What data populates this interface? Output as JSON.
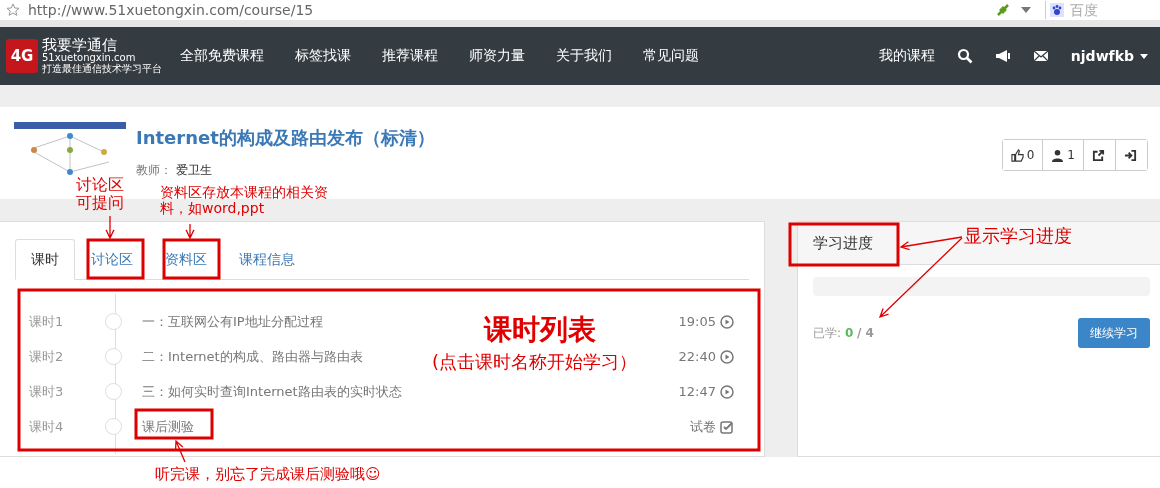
{
  "browser": {
    "url": "http://www.51xuetongxin.com/course/15",
    "search_placeholder": "百度"
  },
  "nav": {
    "logo_mark": "4G",
    "logo_title": "我要学通信",
    "logo_domain": "51xuetongxin.com",
    "logo_tagline": "打造最佳通信技术学习平台",
    "items": [
      "全部免费课程",
      "标签找课",
      "推荐课程",
      "师资力量",
      "关于我们",
      "常见问题"
    ],
    "my_courses": "我的课程",
    "user": "njdwfkb"
  },
  "course": {
    "title": "Internet的构成及路由发布（标清）",
    "teacher_label": "教师：",
    "teacher": "爱卫生",
    "actions": [
      {
        "kind": "like",
        "label": "0"
      },
      {
        "kind": "students",
        "label": "1"
      },
      {
        "kind": "share"
      },
      {
        "kind": "enter"
      }
    ]
  },
  "tabs": [
    {
      "label": "课时",
      "selected": true
    },
    {
      "label": "讨论区",
      "selected": false
    },
    {
      "label": "资料区",
      "selected": false
    },
    {
      "label": "课程信息",
      "selected": false
    }
  ],
  "lessons": [
    {
      "number": "课时1",
      "title": "一：互联网公有IP地址分配过程",
      "info": "19:05",
      "kind": "video"
    },
    {
      "number": "课时2",
      "title": "二：Internet的构成、路由器与路由表",
      "info": "22:40",
      "kind": "video"
    },
    {
      "number": "课时3",
      "title": "三：如何实时查询Internet路由表的实时状态",
      "info": "12:47",
      "kind": "video"
    },
    {
      "number": "课时4",
      "title": "课后测验",
      "info": "试卷",
      "kind": "exam"
    }
  ],
  "progress": {
    "title": "学习进度",
    "level": 0,
    "learned_label": "已学:",
    "done": "0",
    "total": "/ 4",
    "button": "继续学习"
  },
  "annotations": [
    "讨论区可提问",
    "资料区存放本课程的相关资料，如word,ppt",
    "课时列表",
    "(点击课时名称开始学习）",
    "听完课，别忘了完成课后测验哦☺",
    "显示学习进度"
  ]
}
